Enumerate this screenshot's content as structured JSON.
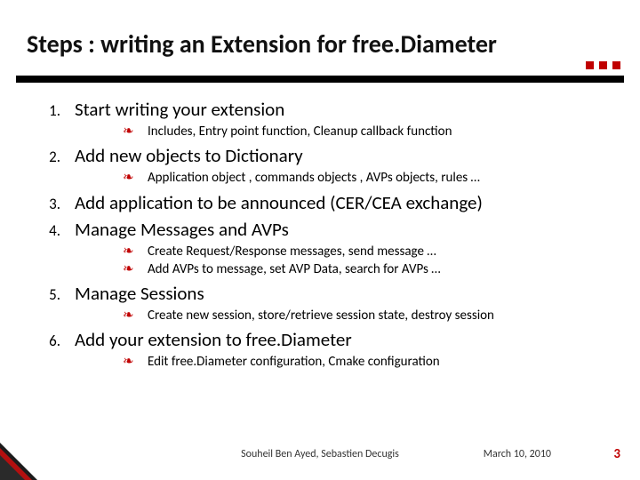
{
  "title": "Steps : writing an Extension for free.Diameter",
  "steps": [
    {
      "num": "1.",
      "text": "Start writing your extension",
      "subs": [
        "Includes, Entry point function, Cleanup callback function"
      ]
    },
    {
      "num": "2.",
      "text": "Add new objects to Dictionary",
      "subs": [
        "Application object , commands objects , AVPs objects, rules …"
      ]
    },
    {
      "num": "3.",
      "text": "Add application to be announced (CER/CEA exchange)",
      "subs": []
    },
    {
      "num": "4.",
      "text": "Manage Messages and AVPs",
      "subs": [
        "Create Request/Response messages, send message …",
        "Add AVPs to message, set AVP Data, search for AVPs …"
      ]
    },
    {
      "num": "5.",
      "text": "Manage Sessions",
      "subs": [
        "Create new session, store/retrieve session state, destroy session"
      ]
    },
    {
      "num": "6.",
      "text": "Add your extension to free.Diameter",
      "subs": [
        "Edit free.Diameter configuration,  Cmake configuration"
      ]
    }
  ],
  "footer": {
    "authors": "Souheil Ben Ayed, Sebastien Decugis",
    "date": "March 10, 2010",
    "page": "3"
  },
  "bullet_char": "❧"
}
